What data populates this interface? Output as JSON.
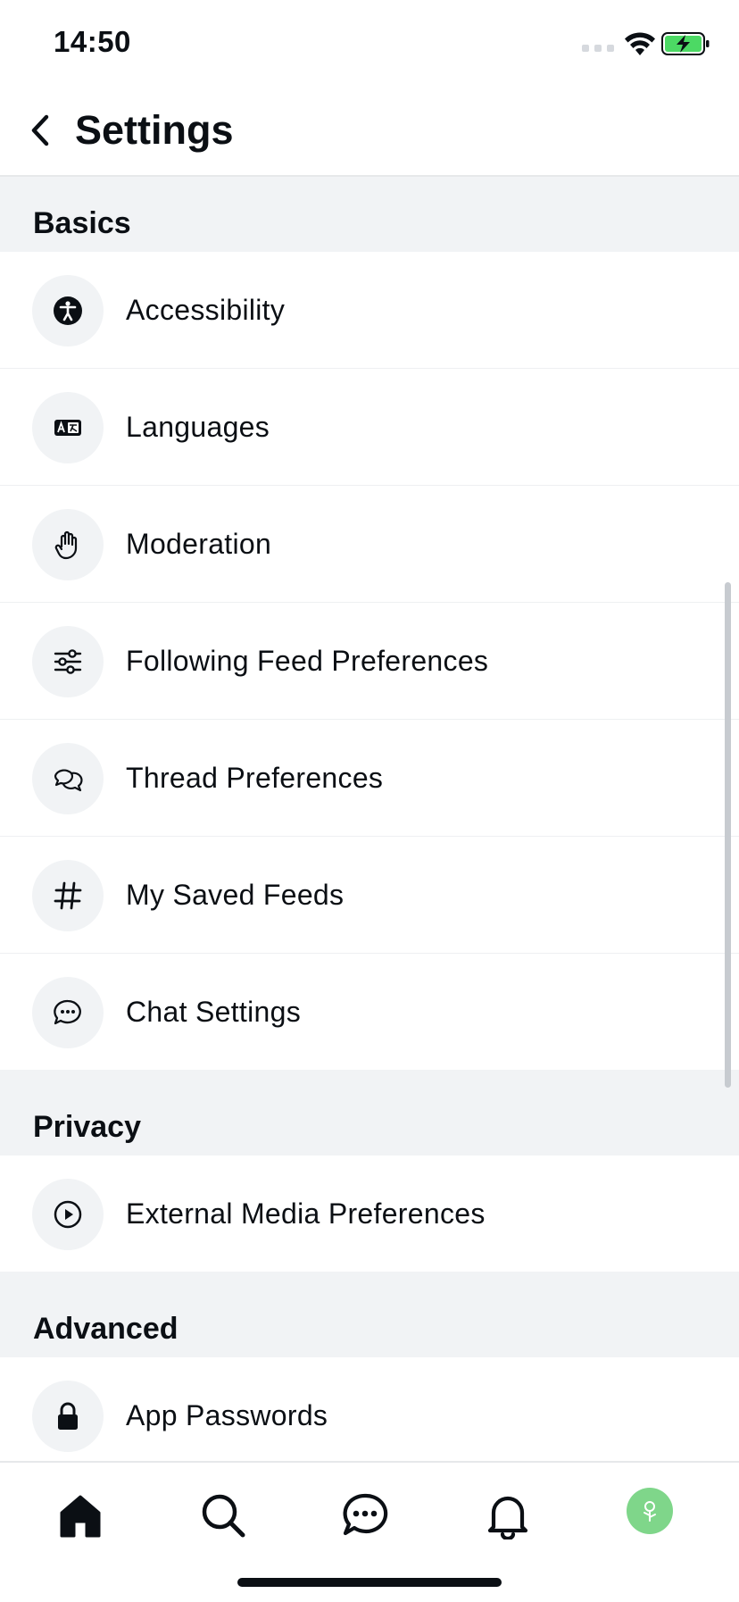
{
  "status_bar": {
    "time": "14:50"
  },
  "header": {
    "title": "Settings"
  },
  "sections": {
    "basics": {
      "title": "Basics",
      "items": [
        {
          "label": "Accessibility",
          "icon": "accessibility-icon"
        },
        {
          "label": "Languages",
          "icon": "languages-icon"
        },
        {
          "label": "Moderation",
          "icon": "hand-icon"
        },
        {
          "label": "Following Feed Preferences",
          "icon": "sliders-icon"
        },
        {
          "label": "Thread Preferences",
          "icon": "chat-bubbles-icon"
        },
        {
          "label": "My Saved Feeds",
          "icon": "hashtag-icon"
        },
        {
          "label": "Chat Settings",
          "icon": "chat-dots-icon"
        }
      ]
    },
    "privacy": {
      "title": "Privacy",
      "items": [
        {
          "label": "External Media Preferences",
          "icon": "play-circle-icon"
        }
      ]
    },
    "advanced": {
      "title": "Advanced",
      "items": [
        {
          "label": "App Passwords",
          "icon": "lock-icon"
        }
      ]
    }
  },
  "tab_bar": {
    "tabs": [
      "home-icon",
      "search-icon",
      "messages-icon",
      "notifications-icon",
      "profile-avatar"
    ]
  },
  "colors": {
    "section_background": "#f1f3f5",
    "icon_circle": "#f1f3f5",
    "avatar": "#7fd68a",
    "battery": "#4cd964",
    "text": "#0b0f14"
  }
}
